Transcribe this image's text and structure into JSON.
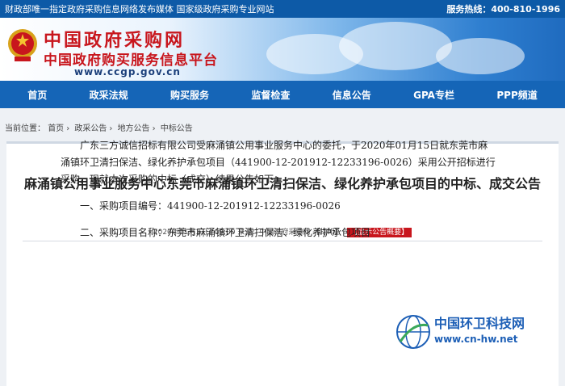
{
  "topbar": {
    "left": "财政部唯一指定政府采购信息网络发布媒体 国家级政府采购专业网站",
    "hotline": "服务热线：400-810-1996"
  },
  "logo": {
    "name": "中国政府采购网",
    "subtitle": "中国政府购买服务信息平台",
    "url": "www.ccgp.gov.cn"
  },
  "nav": {
    "items": [
      "首页",
      "政采法规",
      "购买服务",
      "监督检查",
      "信息公告",
      "GPA专栏",
      "PPP频道"
    ]
  },
  "breadcrumb": {
    "prefix": "当前位置：",
    "items": [
      "首页",
      "政采公告",
      "地方公告",
      "中标公告"
    ]
  },
  "article": {
    "title": "麻涌镇公用事业服务中心东莞市麻涌镇环卫清扫保洁、绿化养护承包项目的中标、成交公告",
    "meta": "2020年01月17日 09:00 来源：中国政府采购网",
    "print_label": "【打印】",
    "summary_label": "【显示公告概要】",
    "paragraph": "广东三方诚信招标有限公司受麻涌镇公用事业服务中心的委托，于2020年01月15日就东莞市麻涌镇环卫清扫保洁、绿化养护承包项目（441900-12-201912-12233196-0026）采用公开招标进行采购。现就本次采购的中标（成交）结果公告如下：",
    "item1": "一、采购项目编号：441900-12-201912-12233196-0026",
    "item2": "二、采购项目名称：东莞市麻涌镇环卫清扫保洁、绿化养护承包项目"
  },
  "watermark": {
    "title": "中国环卫科技网",
    "url": "www.cn-hw.net"
  },
  "colors": {
    "brand_blue": "#1565b7",
    "brand_red": "#c8161d"
  }
}
